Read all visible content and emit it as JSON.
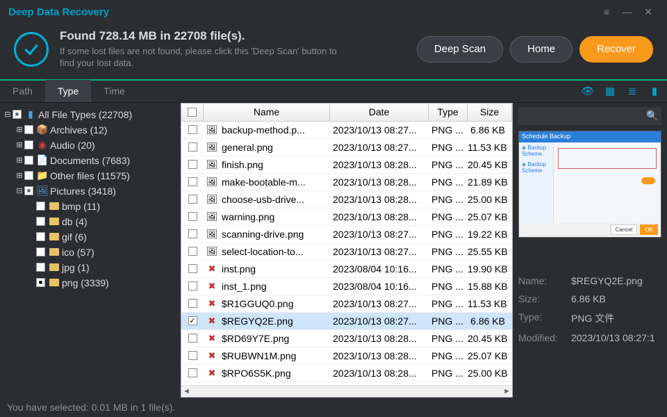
{
  "titlebar": {
    "title": "Deep Data Recovery"
  },
  "header": {
    "found": "Found 728.14 MB in 22708 file(s).",
    "hint": "If some lost files are not found, please click this 'Deep Scan' button to find your lost data.",
    "deep_scan": "Deep Scan",
    "home": "Home",
    "recover": "Recover"
  },
  "tabs": {
    "path": "Path",
    "type": "Type",
    "time": "Time"
  },
  "tree": {
    "root": "All File Types (22708)",
    "archives": "Archives (12)",
    "audio": "Audio (20)",
    "documents": "Documents (7683)",
    "other": "Other files (11575)",
    "pictures": "Pictures (3418)",
    "bmp": "bmp (11)",
    "db": "db (4)",
    "gif": "gif (6)",
    "ico": "ico (57)",
    "jpg": "jpg (1)",
    "png": "png (3339)"
  },
  "columns": {
    "name": "Name",
    "date": "Date",
    "type": "Type",
    "size": "Size"
  },
  "files": [
    {
      "name": "backup-method.p...",
      "date": "2023/10/13 08:27...",
      "type": "PNG ...",
      "size": "6.86 KB",
      "bad": false
    },
    {
      "name": "general.png",
      "date": "2023/10/13 08:27...",
      "type": "PNG ...",
      "size": "11.53 KB",
      "bad": false
    },
    {
      "name": "finish.png",
      "date": "2023/10/13 08:28...",
      "type": "PNG ...",
      "size": "20.45 KB",
      "bad": false
    },
    {
      "name": "make-bootable-m...",
      "date": "2023/10/13 08:28...",
      "type": "PNG ...",
      "size": "21.89 KB",
      "bad": false
    },
    {
      "name": "choose-usb-drive...",
      "date": "2023/10/13 08:28...",
      "type": "PNG ...",
      "size": "25.00 KB",
      "bad": false
    },
    {
      "name": "warning.png",
      "date": "2023/10/13 08:28...",
      "type": "PNG ...",
      "size": "25.07 KB",
      "bad": false
    },
    {
      "name": "scanning-drive.png",
      "date": "2023/10/13 08:27...",
      "type": "PNG ...",
      "size": "19.22 KB",
      "bad": false
    },
    {
      "name": "select-location-to...",
      "date": "2023/10/13 08:27...",
      "type": "PNG ...",
      "size": "25.55 KB",
      "bad": false
    },
    {
      "name": "inst.png",
      "date": "2023/08/04 10:16...",
      "type": "PNG ...",
      "size": "19.90 KB",
      "bad": true
    },
    {
      "name": "inst_1.png",
      "date": "2023/08/04 10:16...",
      "type": "PNG ...",
      "size": "15.88 KB",
      "bad": true
    },
    {
      "name": "$R1GGUQ0.png",
      "date": "2023/10/13 08:27...",
      "type": "PNG ...",
      "size": "11.53 KB",
      "bad": true
    },
    {
      "name": "$REGYQ2E.png",
      "date": "2023/10/13 08:27...",
      "type": "PNG ...",
      "size": "6.86 KB",
      "bad": true,
      "selected": true,
      "checked": true
    },
    {
      "name": "$RD69Y7E.png",
      "date": "2023/10/13 08:28...",
      "type": "PNG ...",
      "size": "20.45 KB",
      "bad": true
    },
    {
      "name": "$RUBWN1M.png",
      "date": "2023/10/13 08:28...",
      "type": "PNG ...",
      "size": "25.07 KB",
      "bad": true
    },
    {
      "name": "$RPO6S5K.png",
      "date": "2023/10/13 08:28...",
      "type": "PNG ...",
      "size": "25.00 KB",
      "bad": true
    }
  ],
  "details": {
    "name_k": "Name:",
    "name_v": "$REGYQ2E.png",
    "size_k": "Size:",
    "size_v": "6.86 KB",
    "type_k": "Type:",
    "type_v": "PNG 文件",
    "mod_k": "Modified:",
    "mod_v": "2023/10/13 08:27:1"
  },
  "status": "You have selected: 0.01 MB in 1 file(s)."
}
